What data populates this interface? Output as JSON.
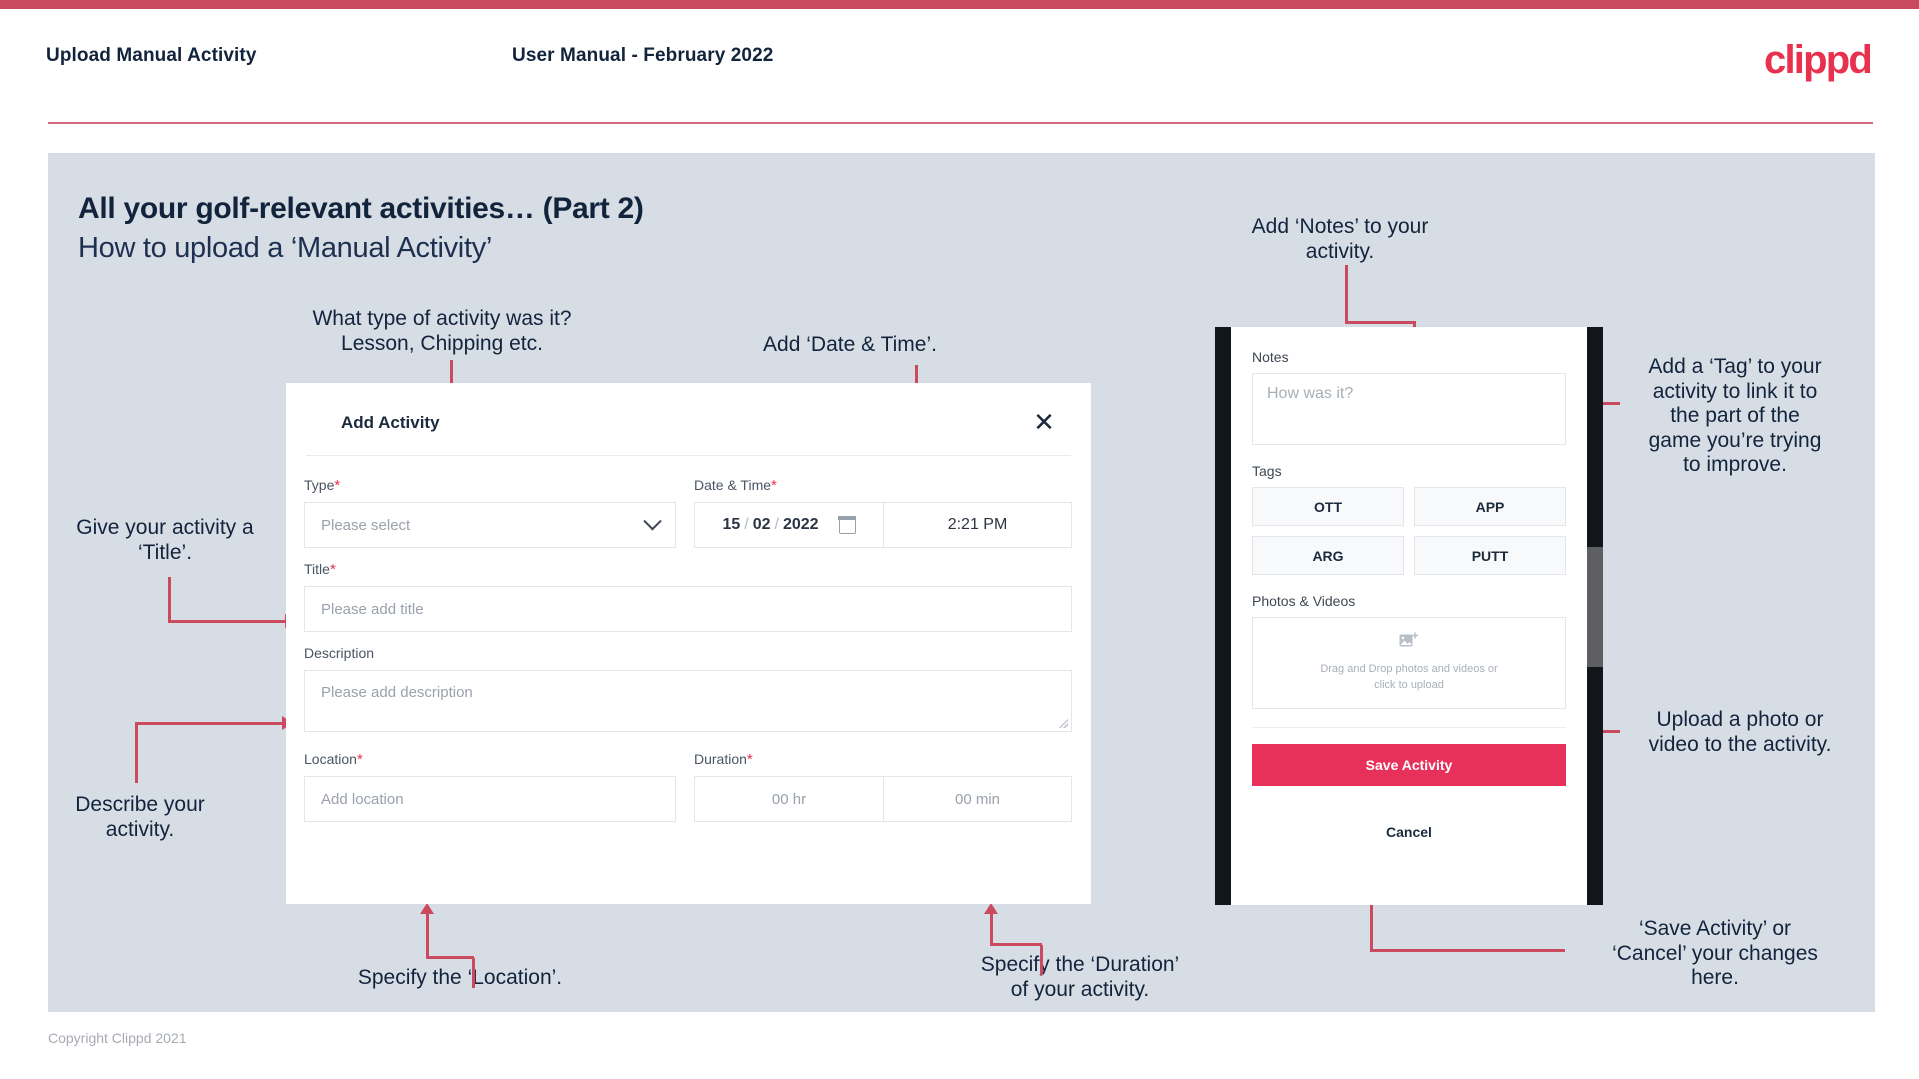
{
  "theme": {
    "accent_pink": "#e8314f",
    "accent_crimson": "#cb4a60",
    "slide_bg": "#d7dde5",
    "text_dark": "#12243c",
    "save_button": "#e8315a"
  },
  "header": {
    "title": "Upload Manual Activity",
    "subtitle": "User Manual - February 2022",
    "logo": "clippd"
  },
  "slide": {
    "title": "All your golf-relevant activities… (Part 2)",
    "subtitle": "How to upload a ‘Manual Activity’"
  },
  "annotations": {
    "type": "What type of activity was it?\nLesson, Chipping etc.",
    "datetime": "Add ‘Date & Time’.",
    "title_field": "Give your activity a\n‘Title’.",
    "description": "Describe your\nactivity.",
    "location": "Specify the ‘Location’.",
    "duration": "Specify the ‘Duration’\nof your activity.",
    "notes": "Add ‘Notes’ to your\nactivity.",
    "tags": "Add a ‘Tag’ to your\nactivity to link it to\nthe part of the\ngame you’re trying\nto improve.",
    "upload": "Upload a photo or\nvideo to the activity.",
    "save_cancel": "‘Save Activity’ or\n‘Cancel’ your changes\nhere."
  },
  "dialog": {
    "title": "Add Activity",
    "close_icon": "close-icon",
    "fields": {
      "type": {
        "label": "Type",
        "required": "*",
        "placeholder": "Please select",
        "icon": "chevron-down-icon"
      },
      "datetime": {
        "label": "Date & Time",
        "required": "*",
        "day": "15",
        "sep1": "/",
        "month": "02",
        "sep2": "/",
        "year": "2022",
        "calendar_icon": "calendar-icon",
        "time": "2:21 PM"
      },
      "title": {
        "label": "Title",
        "required": "*",
        "placeholder": "Please add title"
      },
      "description": {
        "label": "Description",
        "required": "",
        "placeholder": "Please add description"
      },
      "location": {
        "label": "Location",
        "required": "*",
        "placeholder": "Add location"
      },
      "duration": {
        "label": "Duration",
        "required": "*",
        "hours_placeholder": "00 hr",
        "minutes_placeholder": "00 min"
      }
    }
  },
  "phone": {
    "notes": {
      "label": "Notes",
      "placeholder": "How was it?"
    },
    "tags": {
      "label": "Tags",
      "items": [
        "OTT",
        "APP",
        "ARG",
        "PUTT"
      ]
    },
    "photos": {
      "label": "Photos & Videos",
      "icon": "add-image-icon",
      "dropzone_line1": "Drag and Drop photos and videos or",
      "dropzone_line2": "click to upload"
    },
    "save_label": "Save Activity",
    "cancel_label": "Cancel"
  },
  "footer": {
    "copyright": "Copyright Clippd 2021"
  }
}
